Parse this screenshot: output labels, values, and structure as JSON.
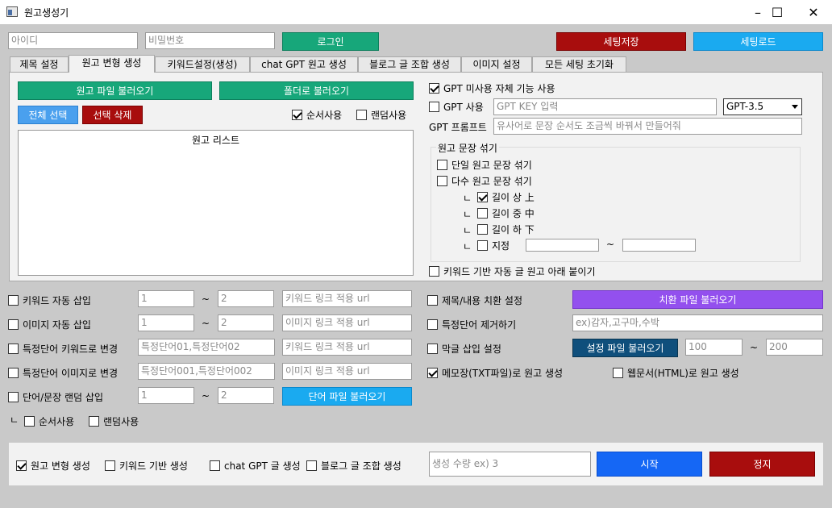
{
  "window": {
    "title": "원고생성기",
    "minimize": "–",
    "maximize": "☐",
    "close": "✕"
  },
  "login": {
    "id_placeholder": "아이디",
    "pw_placeholder": "비밀번호",
    "login_label": "로그인",
    "save_settings_label": "세팅저장",
    "load_settings_label": "세팅로드"
  },
  "tabs": [
    {
      "label": "제목 설정"
    },
    {
      "label": "원고 변형 생성"
    },
    {
      "label": "키워드설정(생성)"
    },
    {
      "label": "chat GPT 원고 생성"
    },
    {
      "label": "블로그 글 조합 생성"
    },
    {
      "label": "이미지 설정"
    },
    {
      "label": "모든 세팅 초기화"
    }
  ],
  "manuscript": {
    "load_file_label": "원고 파일 불러오기",
    "load_folder_label": "폴더로 불러오기",
    "select_all_label": "전체 선택",
    "delete_selected_label": "선택 삭제",
    "sequential_label": "순서사용",
    "random_label": "랜덤사용",
    "list_header": "원고 리스트"
  },
  "gpt": {
    "no_gpt_label": "GPT 미사용 자체 기능 사용",
    "use_gpt_label": "GPT 사용",
    "key_placeholder": "GPT KEY 입력",
    "model": "GPT-3.5",
    "prompt_label": "GPT 프롬프트",
    "prompt_value": "유사어로 문장 순서도 조금씩 바꿔서 만들어줘"
  },
  "mix": {
    "group_title": "원고 문장 섞기",
    "single_label": "단일 원고 문장 섞기",
    "multi_label": "다수 원고 문장 섞기",
    "branch": "ㄴ",
    "len_high_label": "길이 상 上",
    "len_mid_label": "길이 중 中",
    "len_low_label": "길이 하 下",
    "custom_label": "지정",
    "tilde": "~",
    "keyword_attach_label": "키워드 기반 자동 글 원고 아래 붙이기"
  },
  "options": {
    "tilde": "~",
    "kw_insert_label": "키워드 자동 삽입",
    "kw_from": "1",
    "kw_to": "2",
    "kw_url_placeholder": "키워드 링크 적용 url",
    "img_insert_label": "이미지 자동 삽입",
    "img_from": "1",
    "img_to": "2",
    "img_url_placeholder": "이미지 링크 적용 url",
    "word_to_kw_label": "특정단어 키워드로 변경",
    "word_to_kw_placeholder": "특정단어01,특정단어02",
    "word_to_kw_url_placeholder": "키워드 링크 적용 url",
    "word_to_img_label": "특정단어 이미지로 변경",
    "word_to_img_placeholder": "특정단어001,특정단어002",
    "word_to_img_url_placeholder": "이미지 링크 적용 url",
    "random_insert_label": "단어/문장 랜덤 삽입",
    "ri_from": "1",
    "ri_to": "2",
    "load_word_file_label": "단어 파일 불러오기",
    "branch": "ㄴ",
    "sequential_label": "순서사용",
    "random_label": "랜덤사용",
    "replace_label": "제목/내용 치환 설정",
    "load_replace_file_label": "치환 파일 불러오기",
    "remove_word_label": "특정단어 제거하기",
    "remove_word_placeholder": "ex)감자,고구마,수박",
    "filler_label": "막글 삽입 설정",
    "load_settings_file_label": "설정 파일 불러오기",
    "filler_from": "100",
    "filler_to": "200",
    "txt_label": "메모장(TXT파일)로 원고 생성",
    "html_label": "웹문서(HTML)로 원고 생성"
  },
  "bottom": {
    "variant_label": "원고 변형 생성",
    "keyword_label": "키워드 기반 생성",
    "gpt_label": "chat GPT 글 생성",
    "blog_label": "블로그 글 조합 생성",
    "count_placeholder": "생성 수량 ex) 3",
    "start_label": "시작",
    "stop_label": "정지"
  },
  "colors": {
    "green": "#17a77a",
    "red": "#a80d0d",
    "cyan": "#1aaaf0",
    "blue": "#1567f5",
    "purple": "#9350ee",
    "navy": "#0f4f7c"
  }
}
